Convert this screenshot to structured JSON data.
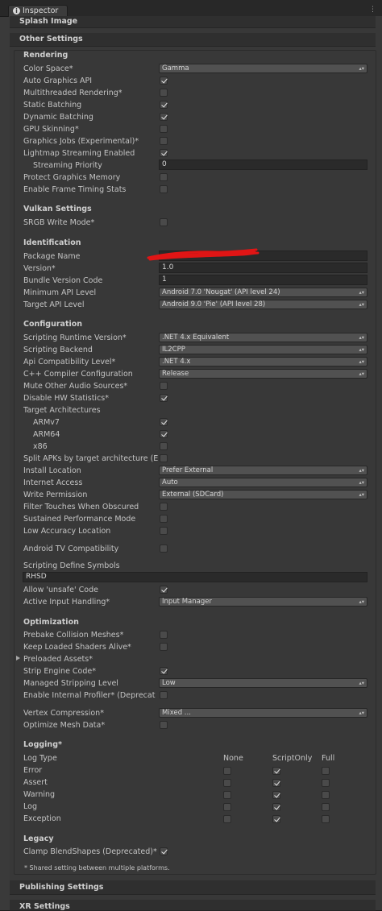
{
  "window": {
    "tab_label": "Inspector",
    "tab_icon": "info-icon",
    "menu_icon": "menu-kebab-icon"
  },
  "sections": {
    "splash_image": "Splash Image",
    "other_settings": "Other Settings",
    "publishing_settings": "Publishing Settings",
    "xr_settings": "XR Settings"
  },
  "rendering": {
    "header": "Rendering",
    "color_space": {
      "label": "Color Space*",
      "value": "Gamma"
    },
    "auto_graphics_api": {
      "label": "Auto Graphics API",
      "checked": true
    },
    "multithreaded_rendering": {
      "label": "Multithreaded Rendering*",
      "checked": false
    },
    "static_batching": {
      "label": "Static Batching",
      "checked": true
    },
    "dynamic_batching": {
      "label": "Dynamic Batching",
      "checked": true
    },
    "gpu_skinning": {
      "label": "GPU Skinning*",
      "checked": false
    },
    "graphics_jobs": {
      "label": "Graphics Jobs (Experimental)*",
      "checked": false
    },
    "lightmap_streaming": {
      "label": "Lightmap Streaming Enabled",
      "checked": true
    },
    "streaming_priority": {
      "label": "Streaming Priority",
      "value": "0"
    },
    "protect_graphics_memory": {
      "label": "Protect Graphics Memory",
      "checked": false
    },
    "frame_timing_stats": {
      "label": "Enable Frame Timing Stats",
      "checked": false
    }
  },
  "vulkan": {
    "header": "Vulkan Settings",
    "srgb_write_mode": {
      "label": "SRGB Write Mode*",
      "checked": false
    }
  },
  "identification": {
    "header": "Identification",
    "package_name": {
      "label": "Package Name",
      "value": ""
    },
    "version": {
      "label": "Version*",
      "value": "1.0"
    },
    "bundle_version_code": {
      "label": "Bundle Version Code",
      "value": "1"
    },
    "minimum_api_level": {
      "label": "Minimum API Level",
      "value": "Android 7.0 'Nougat' (API level 24)"
    },
    "target_api_level": {
      "label": "Target API Level",
      "value": "Android 9.0 'Pie' (API level 28)"
    }
  },
  "configuration": {
    "header": "Configuration",
    "scripting_runtime_version": {
      "label": "Scripting Runtime Version*",
      "value": ".NET 4.x Equivalent"
    },
    "scripting_backend": {
      "label": "Scripting Backend",
      "value": "IL2CPP"
    },
    "api_compatibility_level": {
      "label": "Api Compatibility Level*",
      "value": ".NET 4.x"
    },
    "cpp_compiler_configuration": {
      "label": "C++ Compiler Configuration",
      "value": "Release"
    },
    "mute_other_audio": {
      "label": "Mute Other Audio Sources*",
      "checked": false
    },
    "disable_hw_statistics": {
      "label": "Disable HW Statistics*",
      "checked": true
    },
    "target_architectures": {
      "label": "Target Architectures"
    },
    "armv7": {
      "label": "ARMv7",
      "checked": true
    },
    "arm64": {
      "label": "ARM64",
      "checked": true
    },
    "x86": {
      "label": "x86",
      "checked": false
    },
    "split_apks": {
      "label": "Split APKs by target architecture (E",
      "checked": false
    },
    "install_location": {
      "label": "Install Location",
      "value": "Prefer External"
    },
    "internet_access": {
      "label": "Internet Access",
      "value": "Auto"
    },
    "write_permission": {
      "label": "Write Permission",
      "value": "External (SDCard)"
    },
    "filter_touches": {
      "label": "Filter Touches When Obscured",
      "checked": false
    },
    "sustained_performance": {
      "label": "Sustained Performance Mode",
      "checked": false
    },
    "low_accuracy_location": {
      "label": "Low Accuracy Location",
      "checked": false
    },
    "android_tv": {
      "label": "Android TV Compatibility",
      "checked": false
    },
    "scripting_define_symbols": {
      "label": "Scripting Define Symbols",
      "value": "RHSD"
    },
    "allow_unsafe_code": {
      "label": "Allow 'unsafe' Code",
      "checked": true
    },
    "active_input_handling": {
      "label": "Active Input Handling*",
      "value": "Input Manager"
    }
  },
  "optimization": {
    "header": "Optimization",
    "prebake_collision": {
      "label": "Prebake Collision Meshes*",
      "checked": false
    },
    "keep_loaded_shaders": {
      "label": "Keep Loaded Shaders Alive*",
      "checked": false
    },
    "preloaded_assets": {
      "label": "Preloaded Assets*"
    },
    "strip_engine_code": {
      "label": "Strip Engine Code*",
      "checked": true
    },
    "managed_stripping_level": {
      "label": "Managed Stripping Level",
      "value": "Low"
    },
    "internal_profiler": {
      "label": "Enable Internal Profiler* (Deprecat",
      "checked": false
    },
    "vertex_compression": {
      "label": "Vertex Compression*",
      "value": "Mixed ..."
    },
    "optimize_mesh_data": {
      "label": "Optimize Mesh Data*",
      "checked": false
    }
  },
  "logging": {
    "header": "Logging*",
    "col_log_type": "Log Type",
    "col_none": "None",
    "col_script_only": "ScriptOnly",
    "col_full": "Full",
    "rows": [
      {
        "label": "Error",
        "none": false,
        "script_only": true,
        "full": false
      },
      {
        "label": "Assert",
        "none": false,
        "script_only": true,
        "full": false
      },
      {
        "label": "Warning",
        "none": false,
        "script_only": true,
        "full": false
      },
      {
        "label": "Log",
        "none": false,
        "script_only": true,
        "full": false
      },
      {
        "label": "Exception",
        "none": false,
        "script_only": true,
        "full": false
      }
    ]
  },
  "legacy": {
    "header": "Legacy",
    "clamp_blendshapes": {
      "label": "Clamp BlendShapes (Deprecated)*",
      "checked": true
    }
  },
  "footnote": "* Shared setting between multiple platforms.",
  "colors": {
    "background": "#383838",
    "header": "#2f2f2f",
    "field": "#515151",
    "text": "#c4c4c4"
  }
}
